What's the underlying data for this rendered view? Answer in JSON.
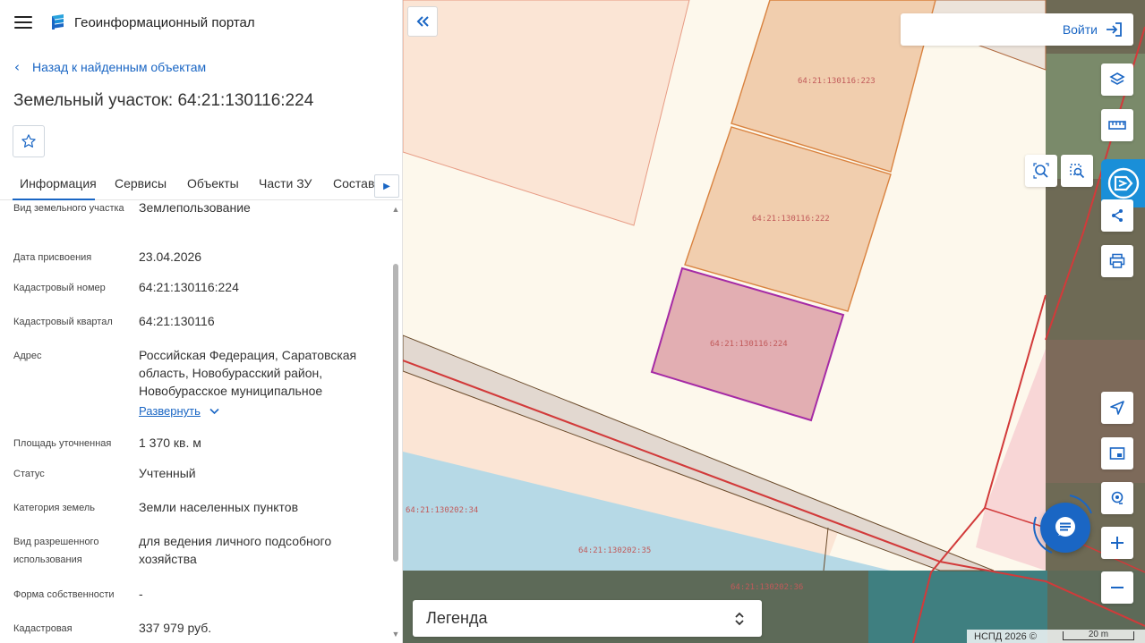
{
  "app": {
    "title": "Геоинформационный портал"
  },
  "sidebar": {
    "back_link": "Назад к найденным объектам",
    "page_title": "Земельный участок: 64:21:130116:224",
    "tabs": [
      {
        "label": "Информация",
        "active": true
      },
      {
        "label": "Сервисы",
        "active": false
      },
      {
        "label": "Объекты",
        "active": false
      },
      {
        "label": "Части ЗУ",
        "active": false
      },
      {
        "label": "Состав",
        "active": false
      }
    ],
    "properties": [
      {
        "label": "Вид земельного участка",
        "value": "Землепользование"
      },
      {
        "label": "Дата присвоения",
        "value": "23.04.2026"
      },
      {
        "label": "Кадастровый номер",
        "value": "64:21:130116:224"
      },
      {
        "label": "Кадастровый квартал",
        "value": "64:21:130116"
      },
      {
        "label": "Адрес",
        "value": "Российская Федерация, Саратовская область, Новобурасский район, Новобурасское муниципальное",
        "expand": "Развернуть"
      },
      {
        "label": "Площадь уточненная",
        "value": "1 370 кв. м"
      },
      {
        "label": "Статус",
        "value": "Учтенный"
      },
      {
        "label": "Категория земель",
        "value": "Земли населенных пунктов"
      },
      {
        "label": "Вид разрешенного использования",
        "value": "для ведения личного подсобного хозяйства"
      },
      {
        "label": "Форма собственности",
        "value": "-"
      },
      {
        "label": "Кадастровая",
        "value": "337 979 руб."
      }
    ]
  },
  "map": {
    "login_label": "Войти",
    "legend_label": "Легенда",
    "copyright": "НСПД 2026 ©",
    "scale_label": "20 m",
    "parcel_labels": [
      "64:21:130116:223",
      "64:21:130116:222",
      "64:21:130116:224",
      "64:21:130202:34",
      "64:21:130202:35",
      "64:21:130202:36"
    ],
    "colors": {
      "accent": "#1a66c4",
      "selected_parcel_fill": "#e2aeb2",
      "selected_parcel_stroke": "#a52aa5",
      "neighbor_parcel_fill": "#f1ceae",
      "road_line": "#d23a3a",
      "water": "#b6d9e6"
    }
  }
}
